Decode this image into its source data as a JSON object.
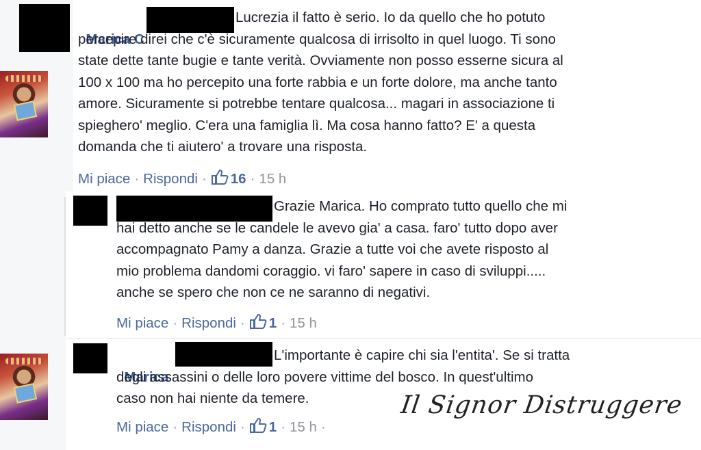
{
  "comments": [
    {
      "author": "Marica C",
      "text": "Lucrezia il fatto è serio. Io da quello che ho potuto\npercepire direi che c'è sicuramente qualcosa di irrisolto in quel luogo. Ti sono\nstate dette tante bugie e tante verità. Ovviamente non posso esserne sicura al\n100 x 100 ma ho percepito una forte rabbia e un forte dolore, ma anche tanto\namore. Sicuramente si potrebbe tentare qualcosa... magari in associazione ti\nspieghero' meglio. C'era una famiglia lì. Ma cosa hanno fatto? E' a questa\ndomanda che ti aiutero' a trovare una risposta.",
      "like_label": "Mi piace",
      "reply_label": "Rispondi",
      "like_count": "16",
      "time": "15 h"
    },
    {
      "author": "",
      "text": "Grazie Marica. Ho comprato tutto quello che mi\nhai detto anche se le candele le avevo gia' a casa. faro' tutto dopo aver\naccompagnato Pamy a danza. Grazie a tutte voi che avete risposto al\nmio problema dandomi coraggio. vi faro' sapere in caso di sviluppi.....\nanche se spero che non ce ne saranno di negativi.",
      "like_label": "Mi piace",
      "reply_label": "Rispondi",
      "like_count": "1",
      "time": "15 h"
    },
    {
      "author": "Marica",
      "text": "L'importante è capire chi sia l'entita'. Se si tratta\ndegli assassini o delle loro povere vittime del bosco. In quest'ultimo\ncaso non hai niente da temere.",
      "like_label": "Mi piace",
      "reply_label": "Rispondi",
      "like_count": "1",
      "time": "15 h"
    }
  ],
  "watermark": "Il Signor Distruggere",
  "colors": {
    "author": "#3b5998",
    "link": "#4b67a1",
    "meta": "#90949c",
    "redaction": "#000000"
  },
  "icons": {
    "like": "thumbs-up-icon"
  }
}
